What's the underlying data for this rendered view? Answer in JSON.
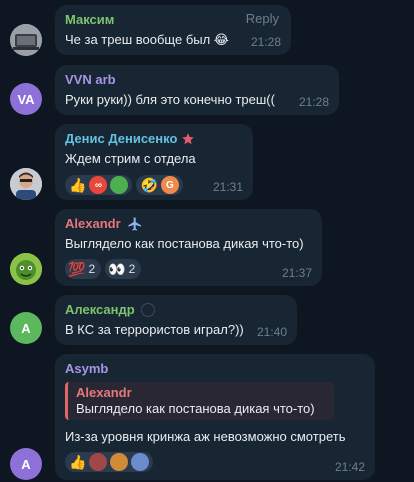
{
  "colors": {
    "background": "#0e1621",
    "bubble": "#182533",
    "name_green": "#7ec46d",
    "name_purple": "#a596e8",
    "name_cyan": "#62c2e0",
    "name_red": "#e7787a",
    "time": "#6d7f8f"
  },
  "messages": [
    {
      "sender": "Максим",
      "text": "Че за треш вообще был 😂",
      "time": "21:28",
      "reply_label": "Reply"
    },
    {
      "sender": "VVN arb",
      "avatar_initials": "VA",
      "text": "Руки руки)) бля это конечно треш((",
      "time": "21:28"
    },
    {
      "sender": "Денис Денисенко",
      "sender_badge_icon": "star-icon",
      "text": "Ждем стрим с отдела",
      "time": "21:31",
      "reactions": [
        "👍",
        "🤣"
      ]
    },
    {
      "sender": "Alexandr",
      "sender_badge_icon": "airplane-icon",
      "text": "Выглядело как постанова дикая что-то)",
      "time": "21:37",
      "reactions": [
        {
          "emoji": "💯",
          "count": "2"
        },
        {
          "emoji": "👀",
          "count": "2"
        }
      ]
    },
    {
      "sender": "Александр",
      "avatar_initials": "A",
      "text": "В КС за террористов играл?))",
      "time": "21:40"
    },
    {
      "sender": "Asymb",
      "avatar_initials": "A",
      "quote_sender": "Alexandr",
      "quote_text": "Выглядело как постанова дикая что-то)",
      "text": "Из-за уровня кринжа аж невозможно смотреть",
      "time": "21:42",
      "reactions": [
        "👍"
      ]
    }
  ]
}
